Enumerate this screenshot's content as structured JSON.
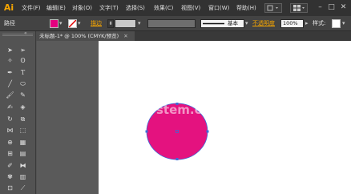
{
  "app": {
    "logo": "Ai"
  },
  "menu": [
    "文件(F)",
    "编辑(E)",
    "对象(O)",
    "文字(T)",
    "选择(S)",
    "效果(C)",
    "视图(V)",
    "窗口(W)",
    "帮助(H)"
  ],
  "window_controls": {
    "minimize": "–",
    "maximize": "□",
    "close": "✕"
  },
  "control_bar": {
    "selection_label": "路径",
    "fill_color": "#e4007f",
    "stroke_label": "描边",
    "stroke_style": "基本",
    "opacity_label": "不透明度",
    "opacity_value": "100%",
    "style_label": "样式:"
  },
  "document_tab": {
    "title": "未标题-1* @ 100% (CMYK/预览)",
    "close": "✕"
  },
  "toolbar": {
    "tools": [
      "selection-tool",
      "direct-selection-tool",
      "magic-wand-tool",
      "lasso-tool",
      "pen-tool",
      "type-tool",
      "line-tool",
      "ellipse-tool",
      "paintbrush-tool",
      "pencil-tool",
      "blob-brush-tool",
      "eraser-tool",
      "rotate-tool",
      "scale-tool",
      "width-tool",
      "free-transform-tool",
      "shape-builder-tool",
      "perspective-grid-tool",
      "mesh-tool",
      "gradient-tool",
      "eyedropper-tool",
      "blend-tool",
      "symbol-sprayer-tool",
      "column-graph-tool",
      "artboard-tool",
      "slice-tool"
    ]
  },
  "canvas": {
    "circle_fill": "#e4127f",
    "watermark": "stem.com"
  },
  "colors": {
    "accent": "#f7a600",
    "selection": "#3d6bd6"
  }
}
